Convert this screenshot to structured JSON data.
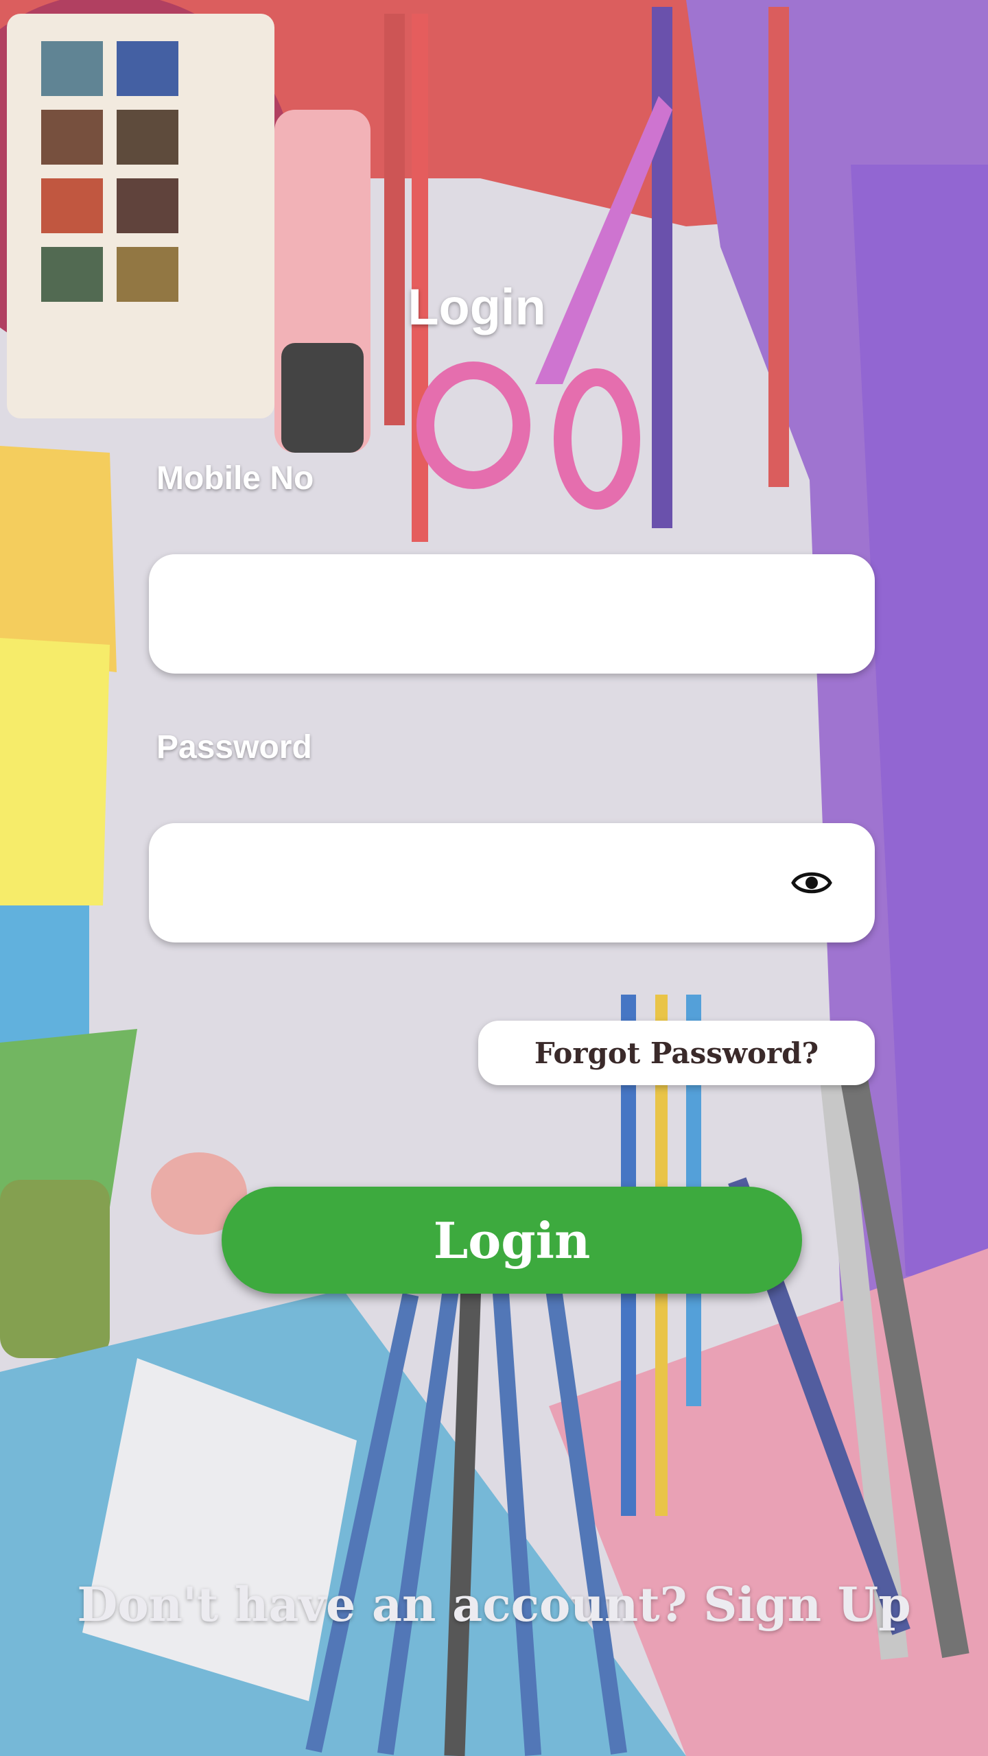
{
  "screen": {
    "title": "Login",
    "mobile_label": "Mobile No",
    "mobile_value": "",
    "password_label": "Password",
    "password_value": "",
    "forgot_label": "Forgot Password?",
    "login_button": "Login",
    "signup_prompt": "Don't have an account?",
    "signup_link": "Sign Up"
  },
  "icons": {
    "password_toggle": "eye-icon"
  },
  "colors": {
    "primary_button": "#3daa3e",
    "field_background": "#ffffff",
    "title_text": "#ffffff"
  }
}
